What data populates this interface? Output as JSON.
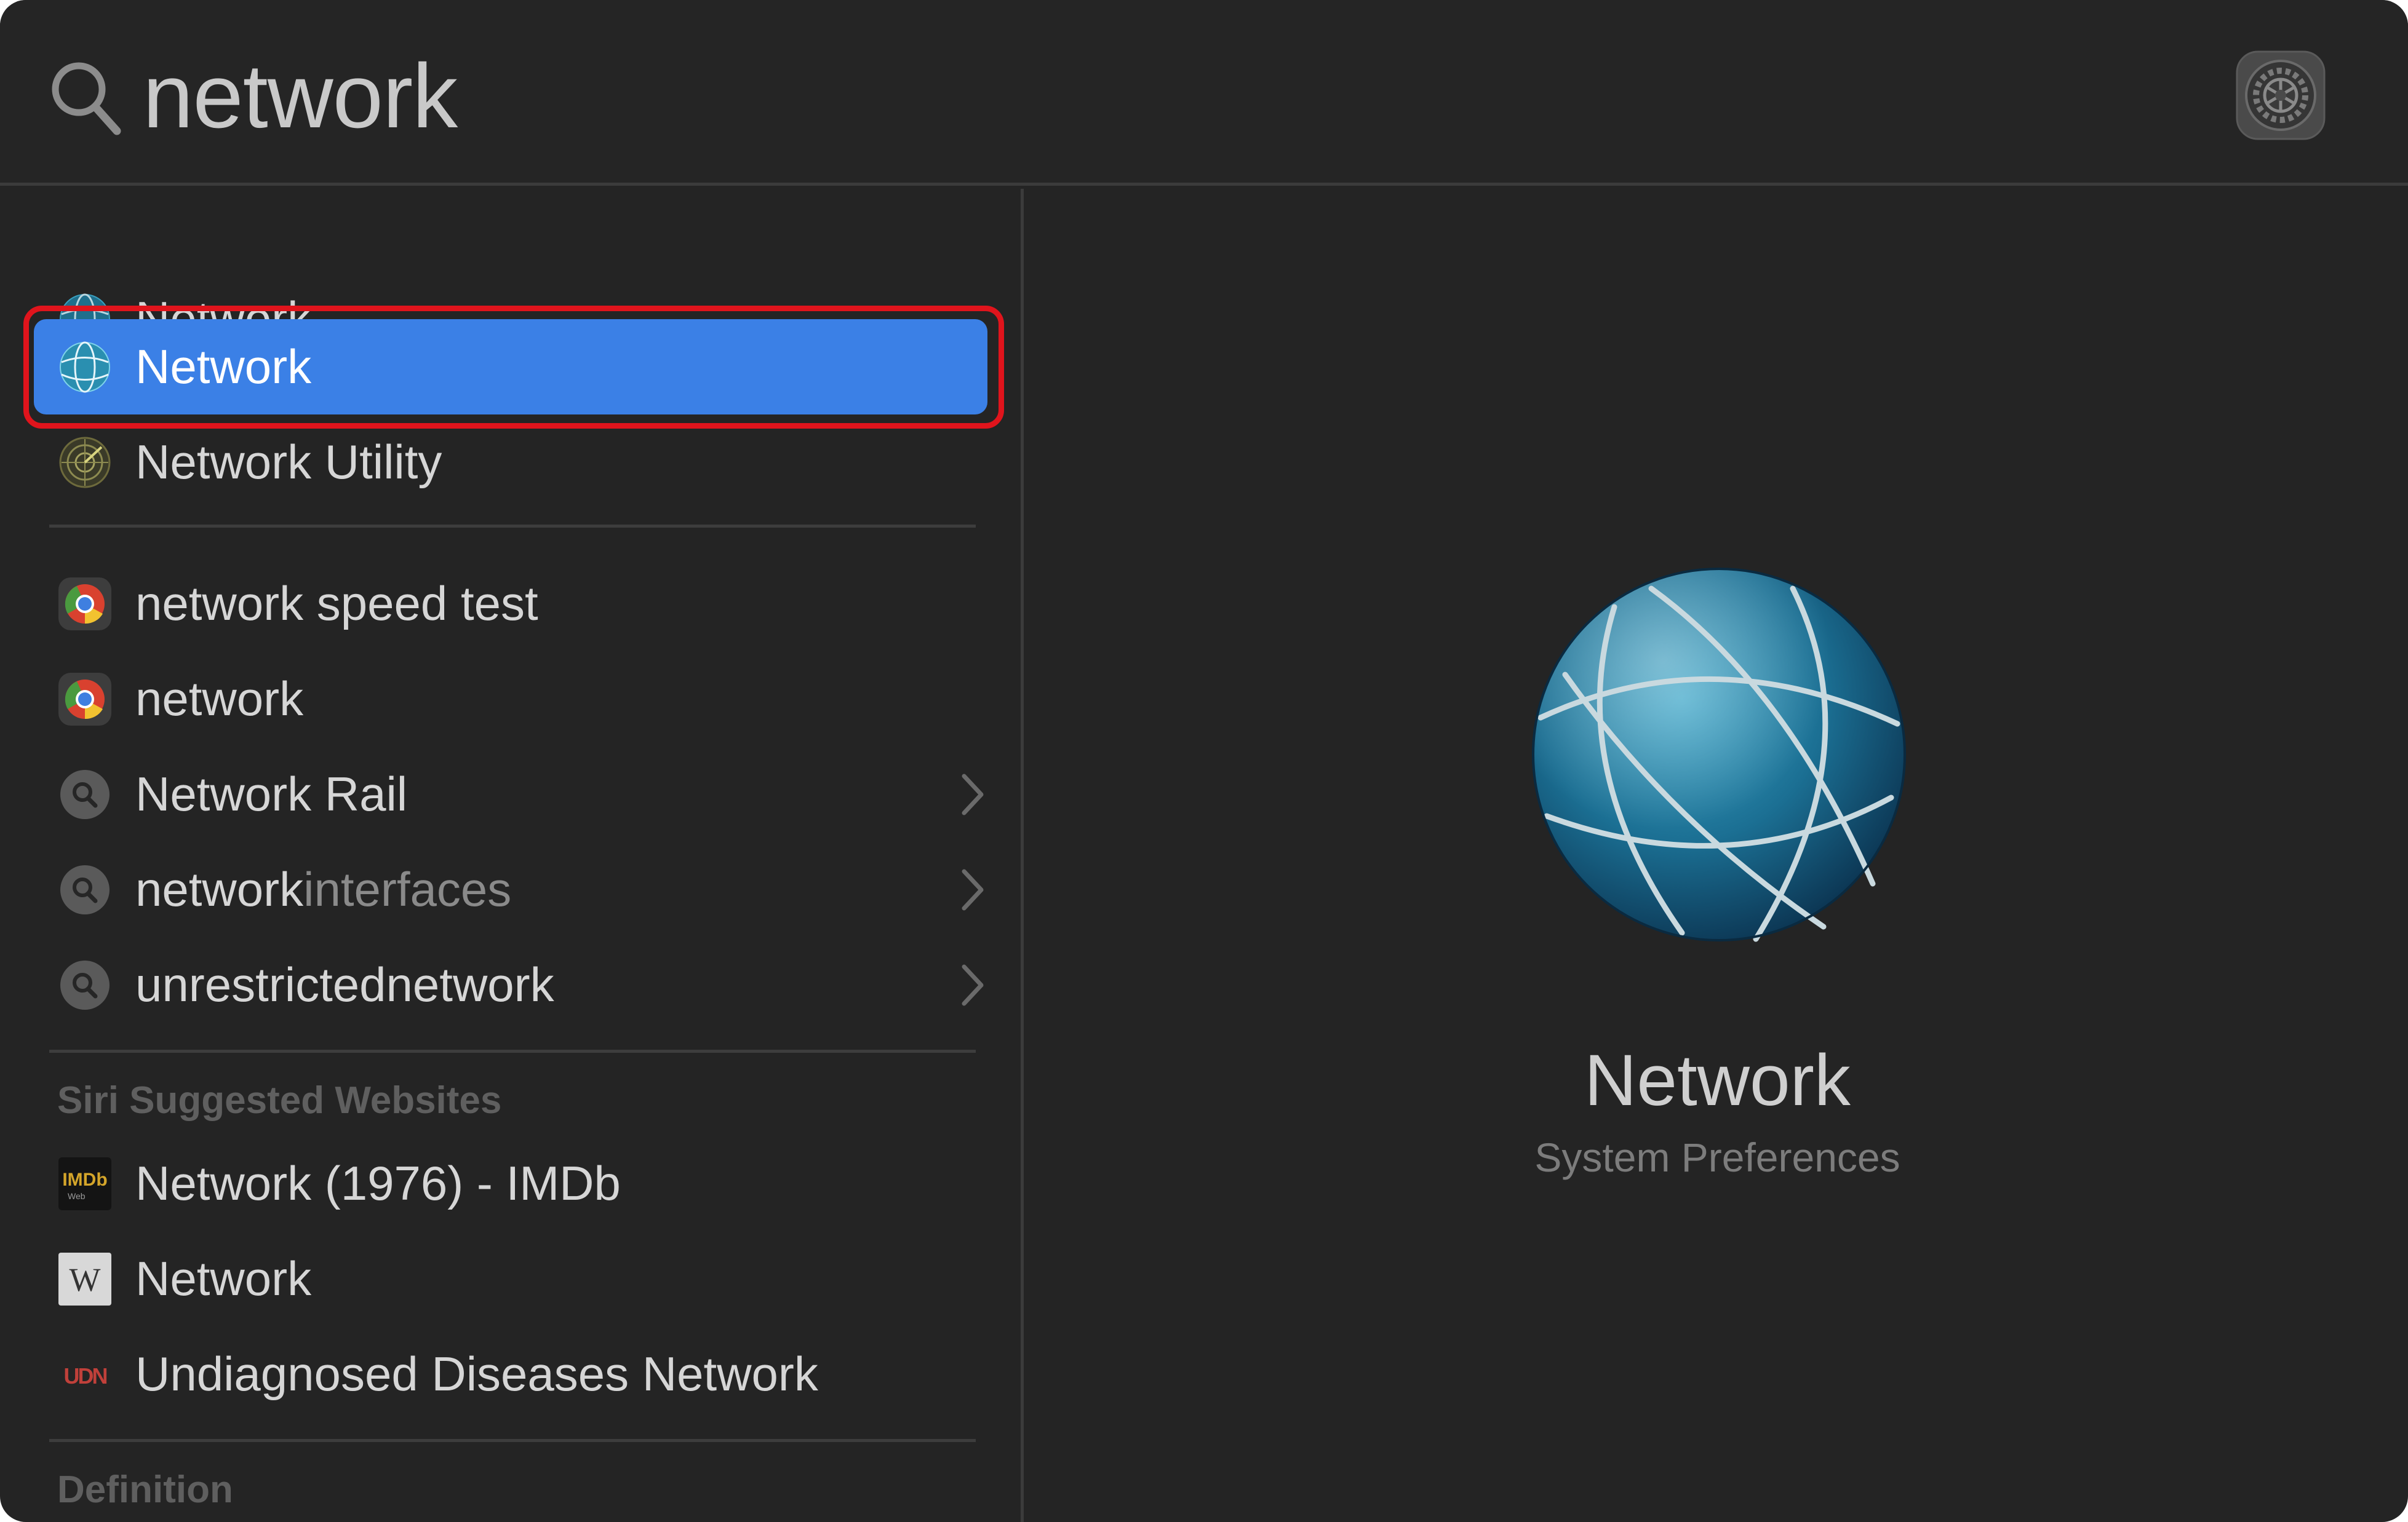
{
  "search": {
    "query": "network"
  },
  "results": {
    "top": [
      {
        "label": "Network",
        "icon": "network-globe-icon"
      },
      {
        "label": "Network",
        "icon": "network-globe-icon",
        "selected": true
      },
      {
        "label": "Network Utility",
        "icon": "network-utility-icon"
      }
    ],
    "suggestions": [
      {
        "label": "network speed test",
        "icon": "chrome-icon"
      },
      {
        "label": "network",
        "icon": "chrome-icon"
      },
      {
        "label": "Network Rail",
        "icon": "search-suggestion-icon"
      },
      {
        "prefix": "network",
        "suffix": "interfaces",
        "icon": "search-suggestion-icon"
      },
      {
        "label": "unrestrictednetwork",
        "icon": "search-suggestion-icon"
      }
    ],
    "siri_header": "Siri Suggested Websites",
    "websites": [
      {
        "label": "Network (1976) - IMDb",
        "icon": "imdb-icon",
        "icon_text": "IMDb",
        "icon_subtext": "Web"
      },
      {
        "label": "Network",
        "icon": "wikipedia-icon",
        "icon_text": "W"
      },
      {
        "label": "Undiagnosed Diseases Network",
        "icon": "udn-icon",
        "icon_text": "UDN"
      }
    ],
    "definition_header": "Definition"
  },
  "preview": {
    "title": "Network",
    "subtitle": "System Preferences"
  },
  "colors": {
    "background": "#242424",
    "selection": "#3b80e6",
    "highlight_border": "#e0141c",
    "divider": "#3d3d3d"
  }
}
